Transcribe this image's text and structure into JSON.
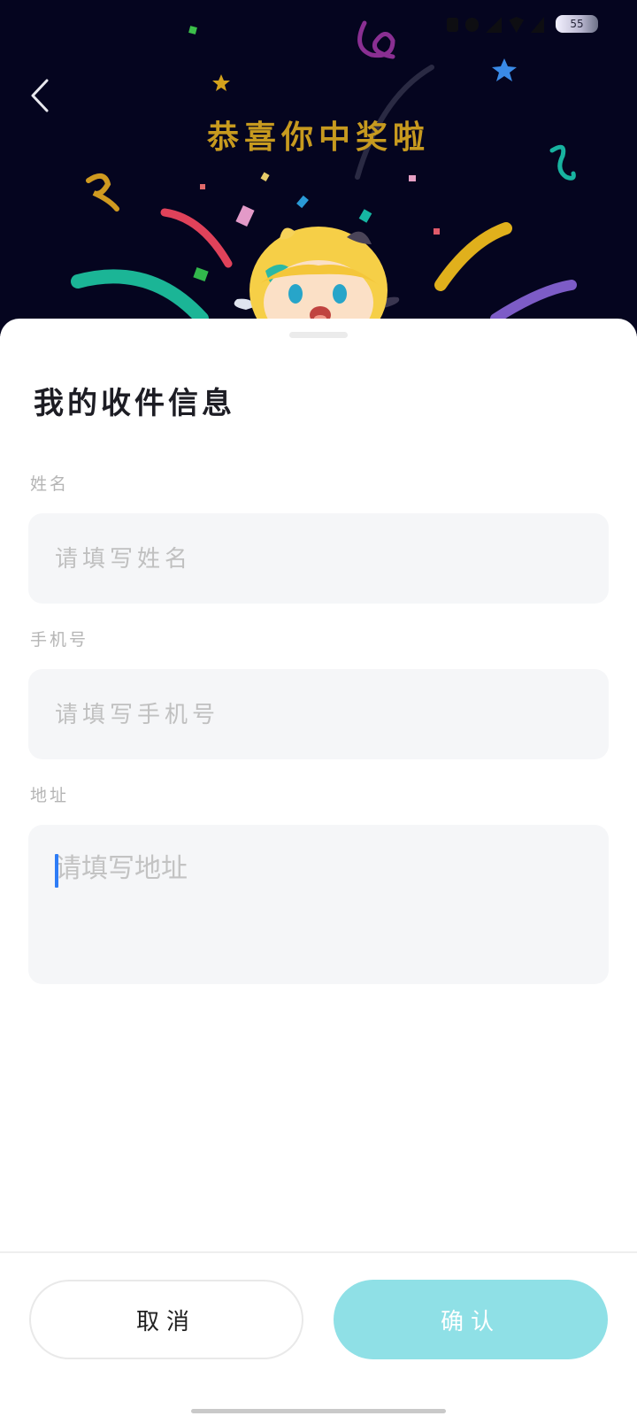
{
  "status_bar": {
    "battery_level": "55"
  },
  "banner": {
    "title": "恭喜你中奖啦",
    "back_icon": "chevron-left-icon",
    "colors": {
      "background": "#05051f",
      "title": "#c79a1f"
    }
  },
  "sheet": {
    "title": "我的收件信息",
    "fields": [
      {
        "label": "姓名",
        "placeholder": "请填写姓名",
        "value": ""
      },
      {
        "label": "手机号",
        "placeholder": "请填写手机号",
        "value": ""
      },
      {
        "label": "地址",
        "placeholder": "请填写地址",
        "value": "",
        "focused": true
      }
    ]
  },
  "footer": {
    "cancel_label": "取消",
    "confirm_label": "确认",
    "colors": {
      "confirm_bg": "#8fe0e6",
      "caret": "#2e7cf6"
    }
  }
}
